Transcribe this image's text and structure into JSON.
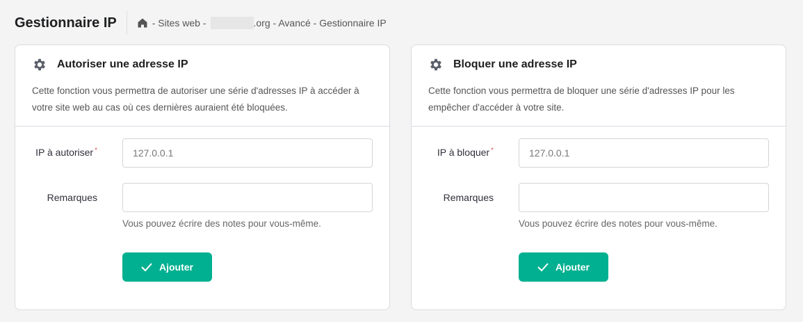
{
  "header": {
    "title": "Gestionnaire IP",
    "breadcrumb": [
      "- Sites web -",
      ".org - Avancé - Gestionnaire IP"
    ]
  },
  "cards": [
    {
      "title": "Autoriser une adresse IP",
      "description": "Cette fonction vous permettra de autoriser une série d'adresses IP à accéder à votre site web au cas où ces dernières auraient été bloquées.",
      "ip_label": "IP à autoriser",
      "ip_placeholder": "127.0.0.1",
      "ip_value": "",
      "notes_label": "Remarques",
      "notes_value": "",
      "notes_help": "Vous pouvez écrire des notes pour vous-même.",
      "button": "Ajouter"
    },
    {
      "title": "Bloquer une adresse IP",
      "description": "Cette fonction vous permettra de bloquer une série d'adresses IP pour les empêcher d'accéder à votre site.",
      "ip_label": "IP à bloquer",
      "ip_placeholder": "127.0.0.1",
      "ip_value": "",
      "notes_label": "Remarques",
      "notes_value": "",
      "notes_help": "Vous pouvez écrire des notes pour vous-même.",
      "button": "Ajouter"
    }
  ],
  "required_mark": "*",
  "colors": {
    "accent": "#00b090"
  }
}
